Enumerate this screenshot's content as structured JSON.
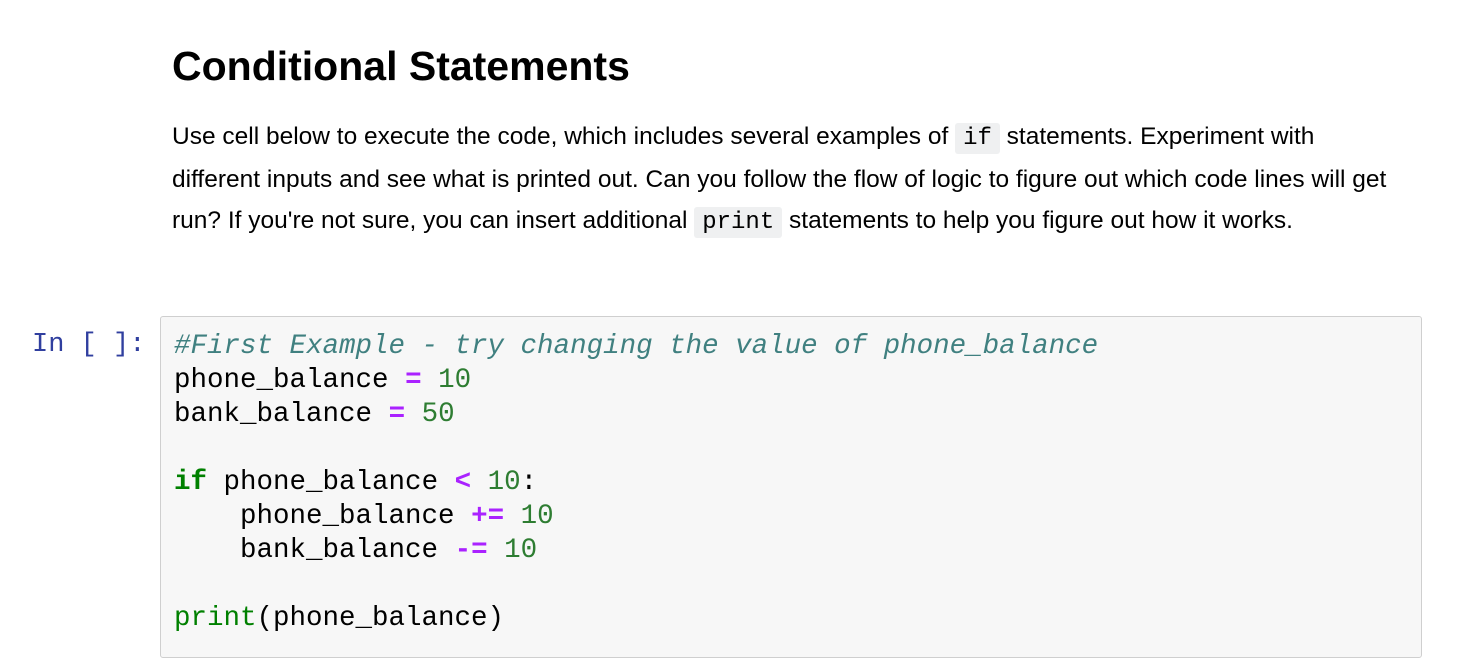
{
  "markdown": {
    "title": "Conditional Statements",
    "p1": "Use cell below to execute the code, which includes several examples of ",
    "code1": "if",
    "p2": " statements. Experiment with different inputs and see what is printed out. Can you follow the flow of logic to figure out which code lines will get run? If you're not sure, you can insert additional ",
    "code2": "print",
    "p3": " statements to help you figure out how it works."
  },
  "cell": {
    "prompt": "In [ ]:",
    "comment": "#First Example - try changing the value of phone_balance",
    "v1": "phone_balance",
    "op1": "=",
    "n1": "10",
    "v2": "bank_balance",
    "op2": "=",
    "n2": "50",
    "kw_if": "if",
    "v3": "phone_balance",
    "op3": "<",
    "n3": "10",
    "colon": ":",
    "v4": "phone_balance",
    "op4": "+=",
    "n4": "10",
    "v5": "bank_balance",
    "op5": "-=",
    "n5": "10",
    "fn_print": "print",
    "arg": "(phone_balance)"
  }
}
